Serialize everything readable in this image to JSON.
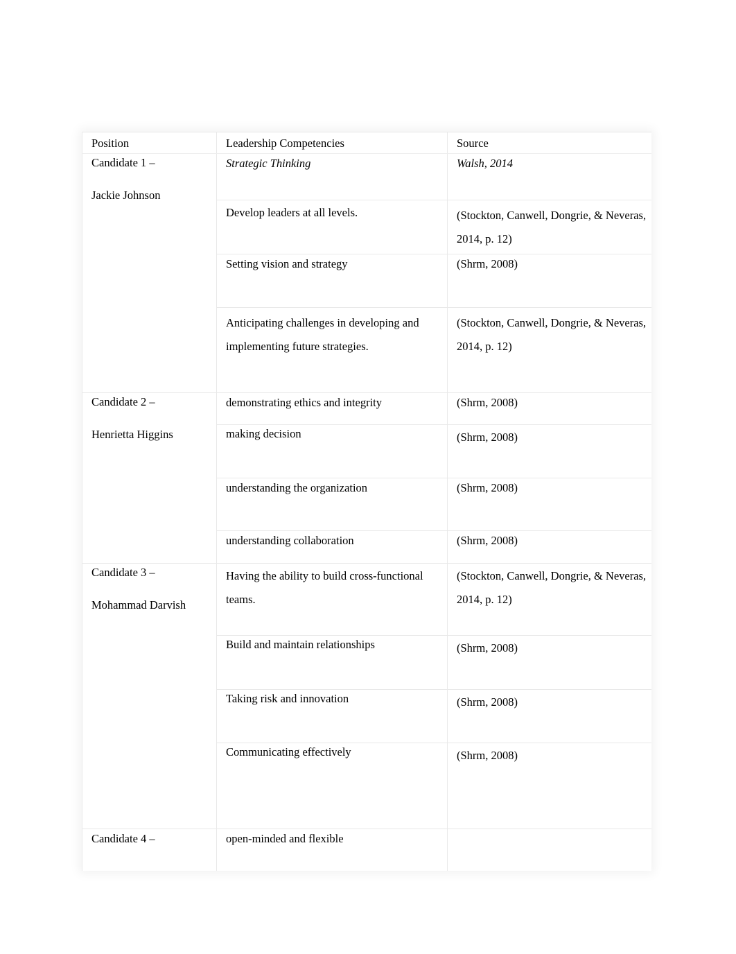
{
  "document": {
    "type": "table",
    "page_background": "#ffffff",
    "table_border_color": "#e9e9e9"
  },
  "table": {
    "headers": {
      "position": "Position",
      "competencies": "Leadership Competencies",
      "source": "Source"
    },
    "candidates": [
      {
        "label": "Candidate 1 –",
        "name": "Jackie Johnson",
        "rows": [
          {
            "competency": "Strategic Thinking",
            "competency_italic": true,
            "source": "Walsh, 2014",
            "source_italic": true
          },
          {
            "competency": "Develop leaders at all levels.",
            "competency_italic": false,
            "source": "(Stockton, Canwell, Dongrie, & Neveras, 2014, p. 12)",
            "source_italic": false
          },
          {
            "competency": "Setting vision and strategy",
            "competency_italic": false,
            "source": "(Shrm, 2008)",
            "source_italic": false
          },
          {
            "competency": "Anticipating challenges in developing and implementing future strategies.",
            "competency_italic": false,
            "source": "(Stockton, Canwell, Dongrie, & Neveras, 2014, p. 12)",
            "source_italic": false
          }
        ]
      },
      {
        "label": "Candidate 2 –",
        "name": "Henrietta Higgins",
        "rows": [
          {
            "competency": "demonstrating ethics and integrity",
            "competency_italic": false,
            "source": "(Shrm, 2008)",
            "source_italic": false
          },
          {
            "competency": "making decision",
            "competency_italic": false,
            "source": "(Shrm, 2008)",
            "source_italic": false
          },
          {
            "competency": "understanding the organization",
            "competency_italic": false,
            "source": "(Shrm, 2008)",
            "source_italic": false
          },
          {
            "competency": "understanding collaboration",
            "competency_italic": false,
            "source": "(Shrm, 2008)",
            "source_italic": false
          }
        ]
      },
      {
        "label": "Candidate 3 –",
        "name": "Mohammad Darvish",
        "rows": [
          {
            "competency": "Having the ability to build cross-functional teams.",
            "competency_italic": false,
            "source": "(Stockton, Canwell, Dongrie, & Neveras, 2014, p. 12)",
            "source_italic": false
          },
          {
            "competency": "Build and maintain relationships",
            "competency_italic": false,
            "source": "(Shrm, 2008)",
            "source_italic": false
          },
          {
            "competency": "Taking risk and innovation",
            "competency_italic": false,
            "source": "(Shrm, 2008)",
            "source_italic": false
          },
          {
            "competency": "Communicating effectively",
            "competency_italic": false,
            "source": "(Shrm, 2008)",
            "source_italic": false
          }
        ]
      },
      {
        "label": "Candidate 4 –",
        "name": "",
        "rows": [
          {
            "competency": "open-minded and flexible",
            "competency_italic": false,
            "source": "",
            "source_italic": false
          }
        ]
      }
    ]
  }
}
